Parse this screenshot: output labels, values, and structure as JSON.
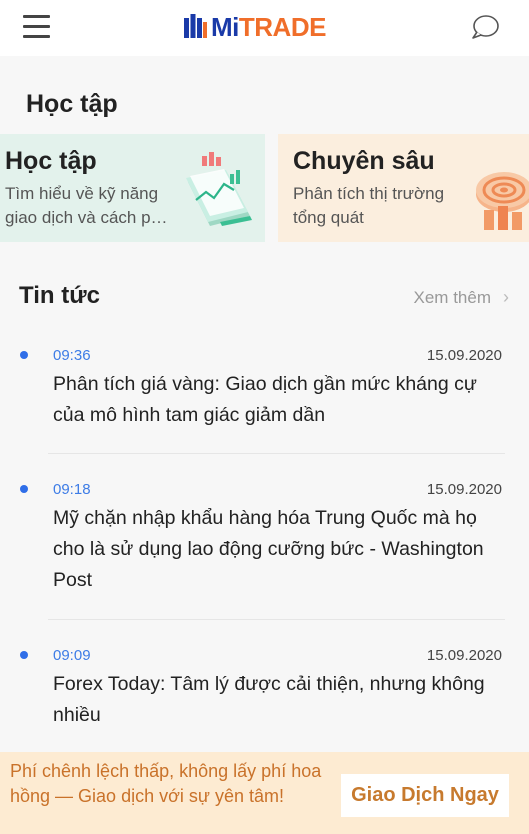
{
  "header": {
    "logo_mi": "Mi",
    "logo_trade": "TRADE"
  },
  "learn": {
    "section_title": "Học tập",
    "cards": [
      {
        "title": "Học tập",
        "desc": "Tìm hiểu về kỹ năng giao dịch và cách p…",
        "art_icon": "chart-book-icon"
      },
      {
        "title": "Chuyên sâu",
        "desc": "Phân tích thị trường tổng quát",
        "art_icon": "target-stack-icon"
      }
    ]
  },
  "news": {
    "title": "Tin tức",
    "more": "Xem thêm",
    "items": [
      {
        "time": "09:36",
        "date": "15.09.2020",
        "text": "Phân tích giá vàng: Giao dịch gần mức kháng cự của mô hình tam giác giảm dần"
      },
      {
        "time": "09:18",
        "date": "15.09.2020",
        "text": "Mỹ chặn nhập khẩu hàng hóa Trung Quốc mà họ cho là sử dụng lao động cưỡng bức - Washington Post"
      },
      {
        "time": "09:09",
        "date": "15.09.2020",
        "text": "Forex Today: Tâm lý được cải thiện, nhưng không nhiều"
      }
    ]
  },
  "banner": {
    "text": "Phí chênh lệch thấp, không lấy phí hoa hồng — Giao dịch với sự yên tâm!",
    "button": "Giao Dịch Ngay"
  },
  "colors": {
    "brand_blue": "#1a3aa8",
    "brand_orange": "#f06e2a",
    "time_blue": "#3d7ce6",
    "banner_bg": "#fdebd2",
    "banner_text": "#c9722a"
  }
}
